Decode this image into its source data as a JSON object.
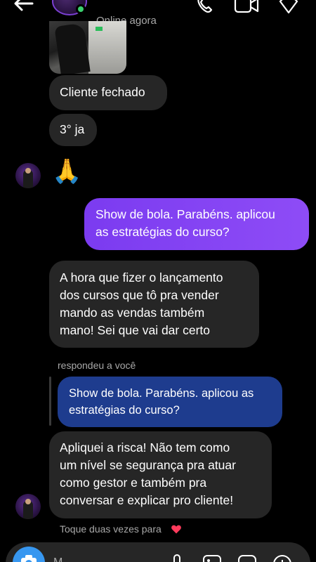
{
  "header": {
    "status": "Online agora"
  },
  "messages": {
    "m1": "Cliente fechado",
    "m2": "3° ja",
    "m3_emoji": "🙏",
    "m4_out_line1": "Show de bola. Parabéns. aplicou",
    "m4_out_line2": "as estratégias do curso?",
    "m5_line1": "A hora que fizer o lançamento",
    "m5_line2": "dos cursos que tô pra vender",
    "m5_line3": "mando as vendas também",
    "m5_line4": "mano! Sei que vai dar certo",
    "reply_label": "respondeu a você",
    "reply_line1": "Show de bola. Parabéns. aplicou  as",
    "reply_line2": "estratégias do curso?",
    "m6_line1": "Apliquei a risca! Não tem como",
    "m6_line2": "um nível se segurança pra atuar",
    "m6_line3": "como gestor e também pra",
    "m6_line4": "conversar e explicar pro cliente!"
  },
  "footer": {
    "hint": "Toque duas vezes para",
    "composer_placeholder": "M"
  },
  "colors": {
    "background": "#000000",
    "incoming_bubble": "#262626",
    "outgoing_bubble": "#8a45f4",
    "reply_bubble": "#1e3c8e",
    "online": "#3bd16f",
    "heart": "#ff3b5c",
    "camera": "#3797f0"
  },
  "icons": [
    "back-arrow-icon",
    "phone-icon",
    "video-camera-icon",
    "flag-icon",
    "heart-icon",
    "camera-icon",
    "mic-icon",
    "gallery-icon",
    "sticker-icon",
    "plus-icon"
  ]
}
